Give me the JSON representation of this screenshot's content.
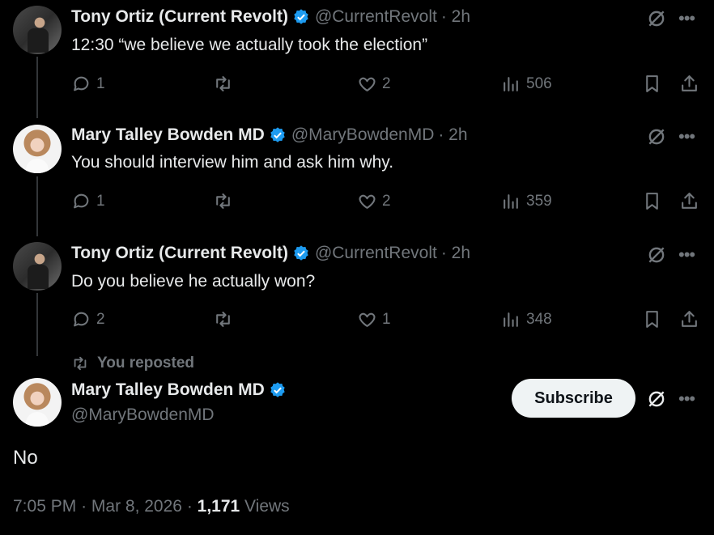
{
  "colors": {
    "accent": "#1d9bf0",
    "muted": "#71767b",
    "text": "#e7e9ea",
    "background": "#000000"
  },
  "replies": [
    {
      "name": "Tony Ortiz (Current Revolt)",
      "handle": "@CurrentRevolt",
      "time": "· 2h",
      "text": "12:30 “we believe we actually took the election”",
      "counts": {
        "replies": "1",
        "reposts": "",
        "likes": "2",
        "views": "506"
      }
    },
    {
      "name": "Mary Talley Bowden MD",
      "handle": "@MaryBowdenMD",
      "time": "· 2h",
      "text": "You should interview him and ask him why.",
      "counts": {
        "replies": "1",
        "reposts": "",
        "likes": "2",
        "views": "359"
      }
    },
    {
      "name": "Tony Ortiz (Current Revolt)",
      "handle": "@CurrentRevolt",
      "time": "· 2h",
      "text": "Do you believe he actually won?",
      "counts": {
        "replies": "2",
        "reposts": "",
        "likes": "1",
        "views": "348"
      }
    }
  ],
  "repost_label": "You reposted",
  "main_post": {
    "name": "Mary Talley Bowden MD",
    "handle": "@MaryBowdenMD",
    "subscribe_label": "Subscribe",
    "text": "No",
    "time": "7:05 PM",
    "date": "Mar 8, 2026",
    "views_count": "1,171",
    "views_label": "Views"
  },
  "icons": [
    "reply-icon",
    "repost-icon",
    "like-icon",
    "views-icon",
    "bookmark-icon",
    "share-icon",
    "grok-icon",
    "more-icon",
    "verified-badge-icon"
  ]
}
